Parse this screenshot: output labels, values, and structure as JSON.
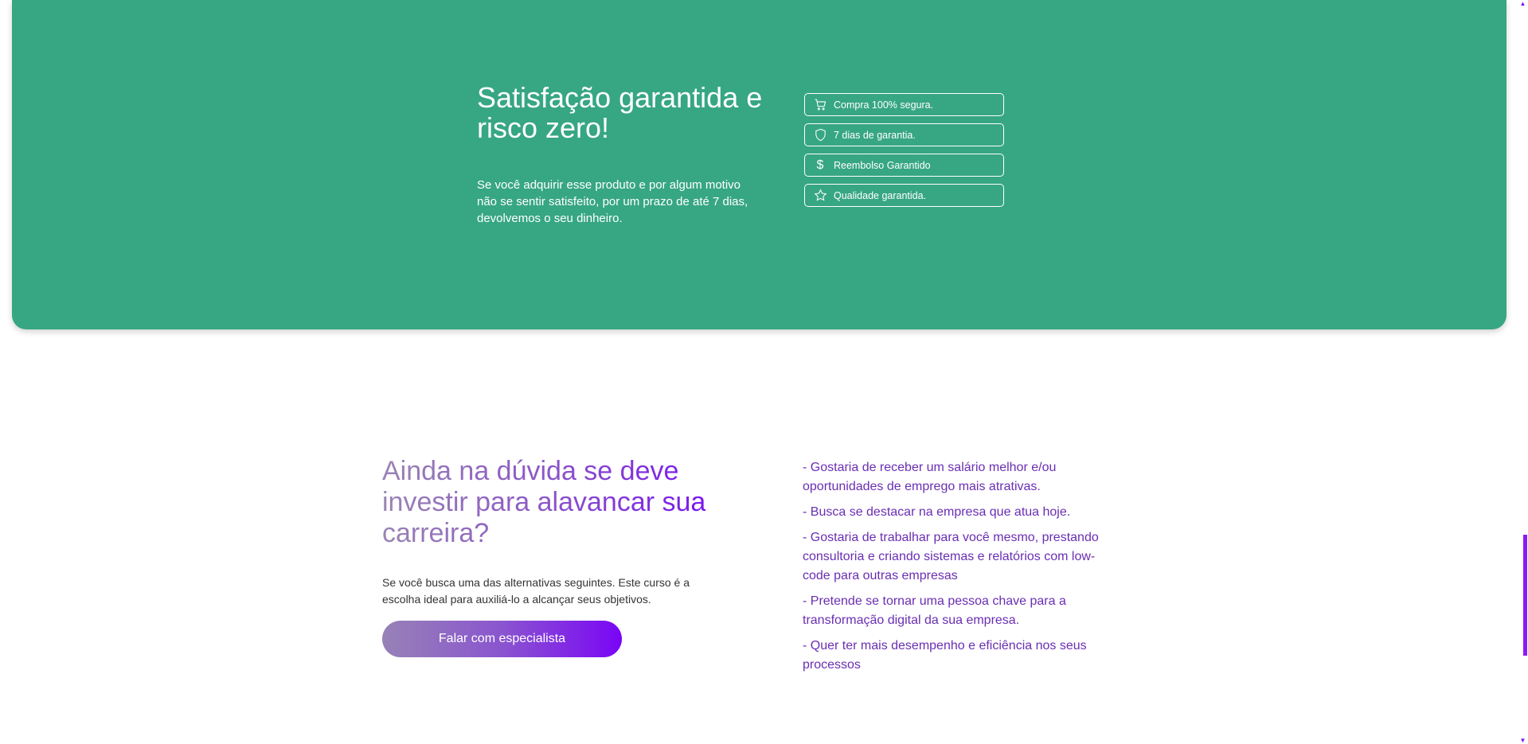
{
  "guarantee": {
    "title": "Satisfação garantida e risco zero!",
    "text": "Se você adquirir esse produto e por algum motivo não se sentir satisfeito, por um prazo de até 7 dias, devolvemos o seu dinheiro.",
    "badges": [
      {
        "icon": "cart-icon",
        "label": "Compra 100% segura."
      },
      {
        "icon": "shield-icon",
        "label": "7 dias de garantia."
      },
      {
        "icon": "dollar-icon",
        "label": "Reembolso Garantido"
      },
      {
        "icon": "star-icon",
        "label": "Qualidade garantida."
      }
    ],
    "background_color": "#37a683"
  },
  "question": {
    "title": "Ainda na dúvida se deve investir para alavancar sua carreira?",
    "text": "Se você busca uma das alternativas seguintes. Este curso é a escolha ideal para auxiliá-lo a alcançar seus objetivos.",
    "cta_label": "Falar com especialista",
    "items": [
      "- Gostaria de receber um salário melhor e/ou oportunidades de emprego mais atrativas.",
      "- Busca se destacar na empresa que atua hoje.",
      "- Gostaria de trabalhar para você mesmo, prestando consultoria e criando sistemas e relatórios com low-code para outras empresas",
      "- Pretende se tornar uma pessoa chave para a transformação digital da sua empresa.",
      "- Quer ter mais desempenho e eficiência nos seus processos"
    ],
    "accent_color": "#7a13f0",
    "list_color": "#6a2eb3"
  },
  "scrollbar": {
    "up_glyph": "▲",
    "down_glyph": "▼",
    "thumb_color": "#8b1af5"
  }
}
